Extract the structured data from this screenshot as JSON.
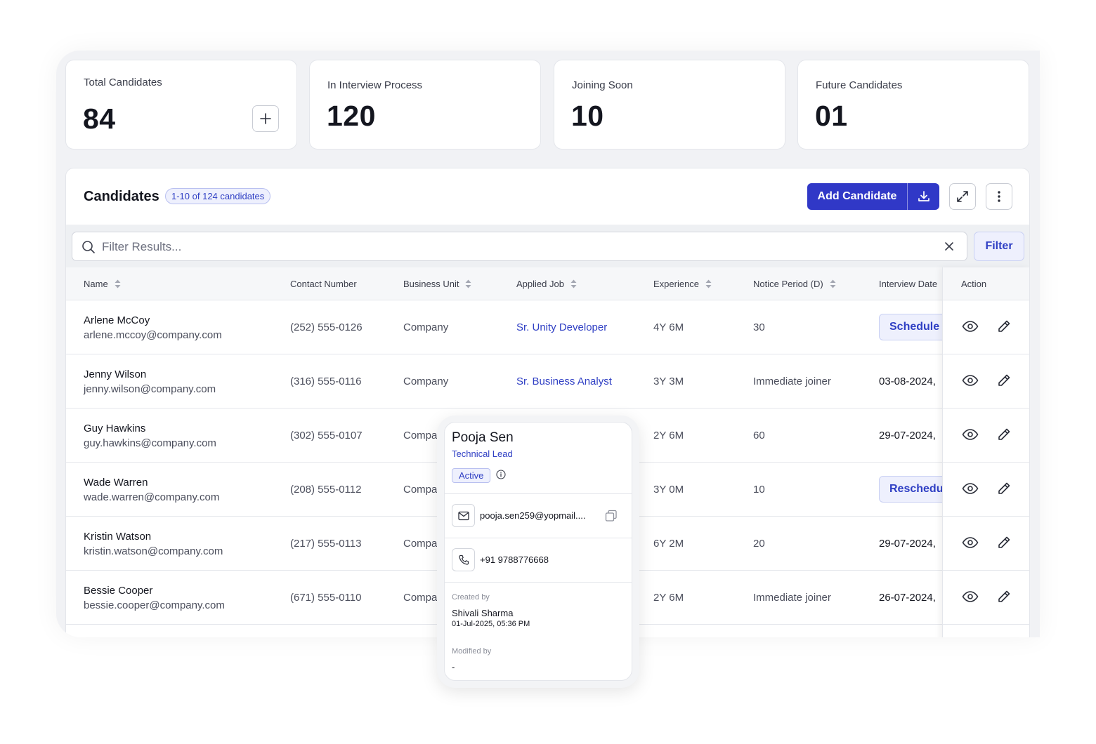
{
  "stats": [
    {
      "label": "Total Candidates",
      "value": "84"
    },
    {
      "label": "In Interview Process",
      "value": "120"
    },
    {
      "label": "Joining Soon",
      "value": "10"
    },
    {
      "label": "Future Candidates",
      "value": "01"
    }
  ],
  "panel": {
    "title": "Candidates",
    "count_badge": "1-10 of 124 candidates",
    "add_button": "Add Candidate",
    "search_placeholder": "Filter Results...",
    "filter_button": "Filter"
  },
  "columns": {
    "name": "Name",
    "contact": "Contact Number",
    "business_unit": "Business Unit",
    "applied_job": "Applied Job",
    "experience": "Experience",
    "notice": "Notice Period (D)",
    "interview_date": "Interview Date",
    "action": "Action"
  },
  "rows": [
    {
      "name": "Arlene McCoy",
      "email": "arlene.mccoy@company.com",
      "phone": "(252) 555-0126",
      "unit": "Company",
      "job": "Sr. Unity Developer",
      "experience": "4Y 6M",
      "notice": "30",
      "interview": "Schedule",
      "interview_is_button": true
    },
    {
      "name": "Jenny Wilson",
      "email": "jenny.wilson@company.com",
      "phone": "(316) 555-0116",
      "unit": "Company",
      "job": "Sr. Business Analyst",
      "experience": "3Y 3M",
      "notice": "Immediate joiner",
      "interview": "03-08-2024,",
      "interview_is_button": false
    },
    {
      "name": "Guy Hawkins",
      "email": "guy.hawkins@company.com",
      "phone": "(302) 555-0107",
      "unit": "Compa",
      "job": "",
      "experience": "2Y 6M",
      "notice": "60",
      "interview": "29-07-2024,",
      "interview_is_button": false
    },
    {
      "name": "Wade Warren",
      "email": "wade.warren@company.com",
      "phone": "(208) 555-0112",
      "unit": "Compa",
      "job": "",
      "experience": "3Y 0M",
      "notice": "10",
      "interview": "Reschedul",
      "interview_is_button": true
    },
    {
      "name": "Kristin Watson",
      "email": "kristin.watson@company.com",
      "phone": "(217) 555-0113",
      "unit": "Compa",
      "job": "",
      "experience": "6Y 2M",
      "notice": "20",
      "interview": "29-07-2024,",
      "interview_is_button": false
    },
    {
      "name": "Bessie Cooper",
      "email": "bessie.cooper@company.com",
      "phone": "(671) 555-0110",
      "unit": "Compa",
      "job": "",
      "experience": "2Y 6M",
      "notice": "Immediate joiner",
      "interview": "26-07-2024,",
      "interview_is_button": false
    }
  ],
  "popup": {
    "name": "Pooja Sen",
    "role": "Technical Lead",
    "status": "Active",
    "email": "pooja.sen259@yopmail....",
    "phone": "+91 9788776668",
    "created_by_label": "Created by",
    "created_by": "Shivali Sharma",
    "created_at": "01-Jul-2025, 05:36 PM",
    "modified_by_label": "Modified by",
    "modified_by": "-"
  },
  "colors": {
    "accent": "#3038c7",
    "link": "#2f3fc4",
    "badge_bg": "#eef0fd"
  }
}
